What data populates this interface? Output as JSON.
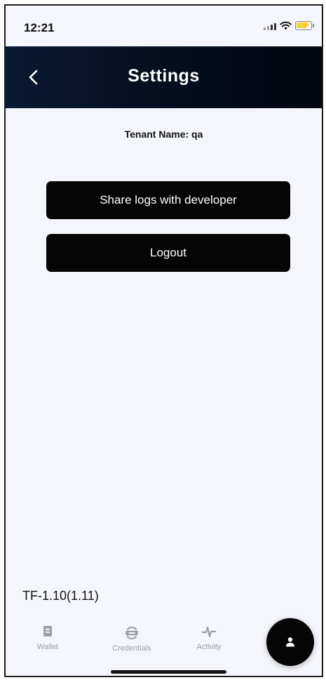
{
  "status_bar": {
    "time": "12:21"
  },
  "header": {
    "title": "Settings",
    "back_icon": "chevron-left-icon"
  },
  "tenant": {
    "label": "Tenant Name: qa"
  },
  "actions": {
    "share_logs_label": "Share logs with developer",
    "logout_label": "Logout"
  },
  "version": "TF-1.10(1.11)",
  "tab_bar": {
    "tabs": [
      {
        "label": "Wallet",
        "icon": "wallet-icon"
      },
      {
        "label": "Credentials",
        "icon": "credentials-icon"
      },
      {
        "label": "Activity",
        "icon": "activity-icon"
      }
    ],
    "profile_icon": "profile-icon"
  },
  "colors": {
    "header_bg": "#061022",
    "background": "#f4f6fb",
    "button_bg": "#050505",
    "tab_inactive": "#9a9ea6"
  }
}
